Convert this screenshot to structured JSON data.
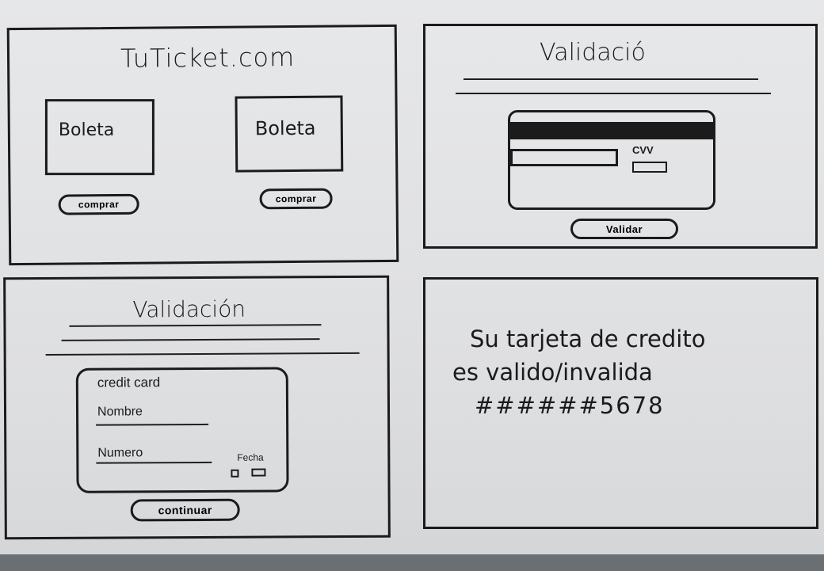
{
  "screen1": {
    "site_title": "TuTicket.com",
    "ticket_left_label": "Boleta",
    "ticket_right_label": "Boleta",
    "buy_left_label": "comprar",
    "buy_right_label": "comprar"
  },
  "screen2": {
    "title": "Validació",
    "cvv_label": "CVV",
    "validate_label": "Validar"
  },
  "screen3": {
    "title": "Validación",
    "card_heading": "credit card",
    "name_label": "Nombre",
    "number_label": "Numero",
    "date_label": "Fecha",
    "continue_label": "continuar"
  },
  "screen4": {
    "message_line1": "Su tarjeta de credito",
    "message_line2": "es valido/invalida",
    "masked_number": "######5678"
  }
}
